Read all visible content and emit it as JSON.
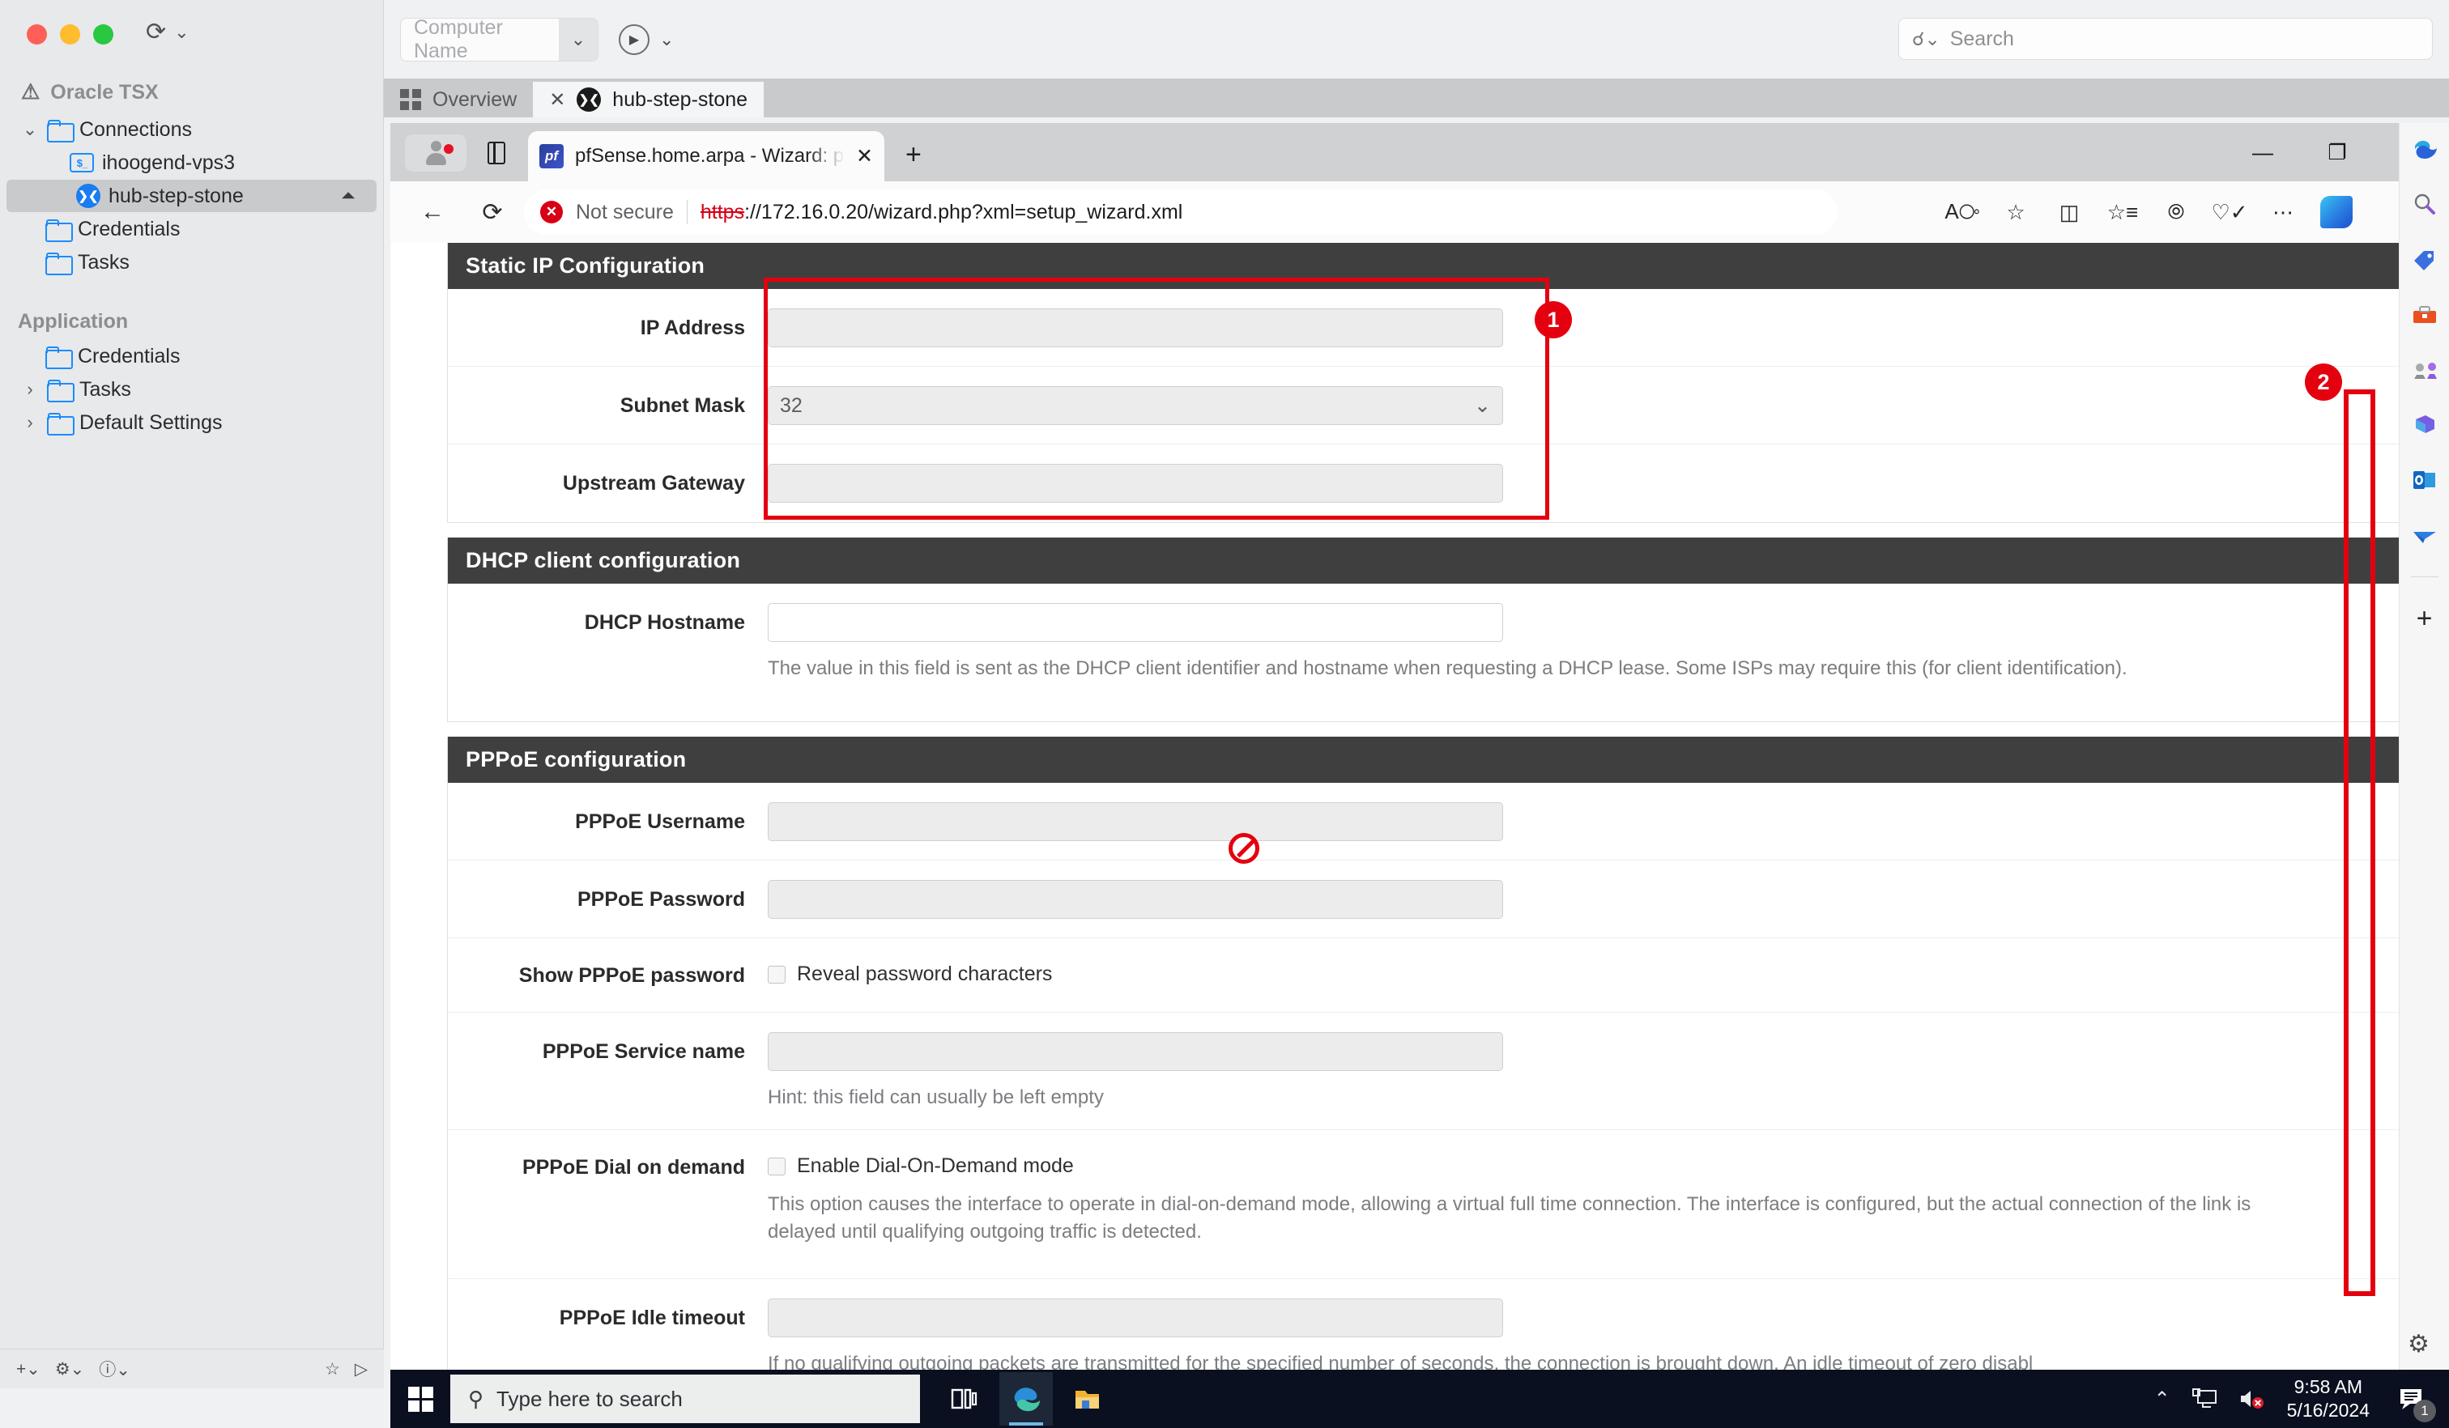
{
  "host_app": {
    "computer_name_placeholder": "Computer Name",
    "search_placeholder": "Search",
    "sidebar": {
      "root_label": "Oracle TSX",
      "groups": [
        {
          "label": "Connections",
          "items": [
            {
              "label": "ihoogend-vps3",
              "icon": "terminal-icon"
            },
            {
              "label": "hub-step-stone",
              "icon": "xshell-icon",
              "selected": true
            },
            {
              "label": "Credentials",
              "icon": "folder-icon"
            },
            {
              "label": "Tasks",
              "icon": "folder-icon"
            }
          ]
        },
        {
          "label": "Application",
          "items": [
            {
              "label": "Credentials",
              "icon": "folder-icon"
            },
            {
              "label": "Tasks",
              "icon": "folder-icon"
            },
            {
              "label": "Default Settings",
              "icon": "folder-icon"
            }
          ]
        }
      ]
    },
    "tabs": [
      {
        "label": "Overview",
        "icon": "grid-icon",
        "active": false
      },
      {
        "label": "hub-step-stone",
        "icon": "xshell-icon",
        "active": true
      }
    ]
  },
  "browser": {
    "tab_title": "pfSense.home.arpa - Wizard: pfS",
    "favicon_text": "pf",
    "security_label": "Not secure",
    "url_scheme": "https",
    "url_rest": "://172.16.0.20/wizard.php?xml=setup_wizard.xml",
    "url_full": "https://172.16.0.20/wizard.php?xml=setup_wizard.xml",
    "new_tab_label": "+",
    "window_controls": {
      "minimize": "—",
      "restore": "❐",
      "close": "✕"
    }
  },
  "pfsense": {
    "sections": [
      {
        "title": "Static IP Configuration",
        "rows": [
          {
            "label": "IP Address",
            "type": "text",
            "value": "",
            "field_style": "disabled"
          },
          {
            "label": "Subnet Mask",
            "type": "select",
            "value": "32",
            "field_style": "disabled"
          },
          {
            "label": "Upstream Gateway",
            "type": "text",
            "value": "",
            "field_style": "disabled"
          }
        ]
      },
      {
        "title": "DHCP client configuration",
        "rows": [
          {
            "label": "DHCP Hostname",
            "type": "text",
            "value": "",
            "field_style": "enabled",
            "help": "The value in this field is sent as the DHCP client identifier and hostname when requesting a DHCP lease. Some ISPs may require this (for client identification)."
          }
        ]
      },
      {
        "title": "PPPoE configuration",
        "rows": [
          {
            "label": "PPPoE Username",
            "type": "text",
            "value": "",
            "field_style": "disabled"
          },
          {
            "label": "PPPoE Password",
            "type": "text",
            "value": "",
            "field_style": "disabled"
          },
          {
            "label": "Show PPPoE password",
            "type": "checkbox",
            "checkbox_label": "Reveal password characters",
            "checked": false
          },
          {
            "label": "PPPoE Service name",
            "type": "text",
            "value": "",
            "field_style": "disabled",
            "help": "Hint: this field can usually be left empty"
          },
          {
            "label": "PPPoE Dial on demand",
            "type": "checkbox",
            "checkbox_label": "Enable Dial-On-Demand mode",
            "checked": false,
            "help": "This option causes the interface to operate in dial-on-demand mode, allowing a virtual full time connection. The interface is configured, but the actual connection of the link is delayed until qualifying outgoing traffic is detected."
          },
          {
            "label": "PPPoE Idle timeout",
            "type": "text",
            "value": "",
            "field_style": "disabled",
            "help": "If no qualifying outgoing packets are transmitted for the specified number of seconds, the connection is brought down. An idle timeout of zero disabl"
          }
        ]
      }
    ]
  },
  "annotations": {
    "badge_1": "1",
    "badge_2": "2",
    "accent_color": "#e4000f"
  },
  "edge_rail_icons": [
    "copilot-icon",
    "search-icon",
    "shopping-tag-icon",
    "tools-toolbox-icon",
    "games-icon",
    "designer-icon",
    "outlook-icon",
    "send-plane-icon",
    "add-icon"
  ],
  "taskbar": {
    "search_placeholder": "Type here to search",
    "apps": [
      "task-view-icon",
      "edge-icon",
      "file-explorer-icon"
    ],
    "time": "9:58 AM",
    "date": "5/16/2024",
    "notification_count": "1"
  }
}
